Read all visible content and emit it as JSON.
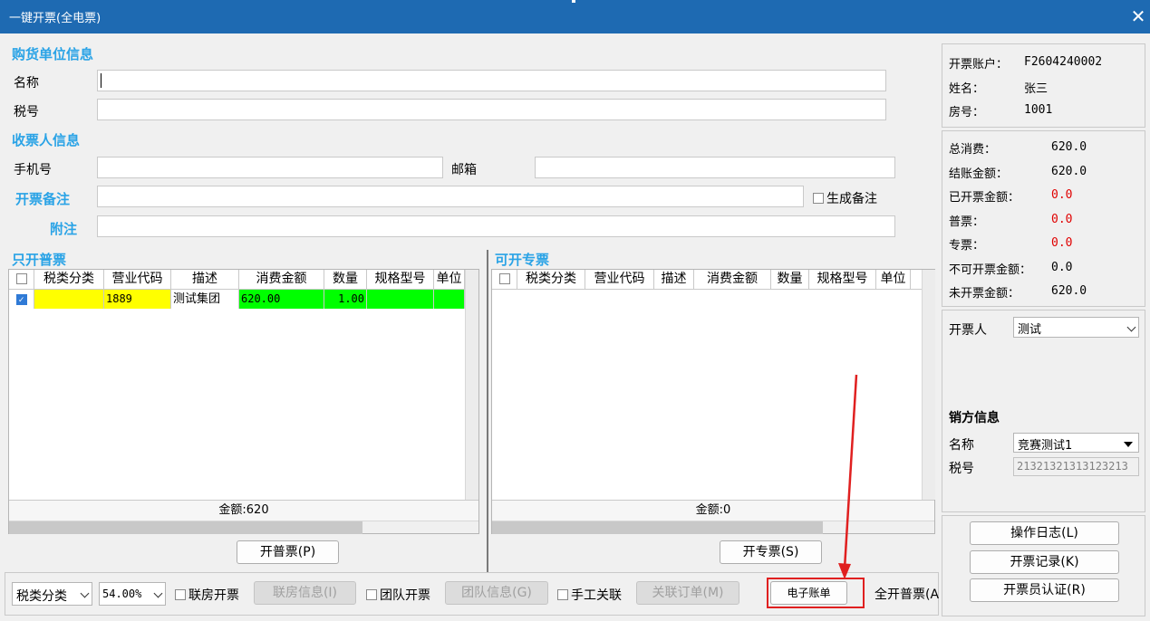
{
  "window": {
    "title": "一键开票(全电票)",
    "close_glyph": "✕"
  },
  "buyer": {
    "section_title": "购货单位信息",
    "name_label": "名称",
    "tax_label": "税号",
    "name_value": "",
    "tax_value": ""
  },
  "receiver": {
    "section_title": "收票人信息",
    "phone_label": "手机号",
    "email_label": "邮箱",
    "phone_value": "",
    "email_value": ""
  },
  "remark": {
    "label": "开票备注",
    "gen_label": "生成备注",
    "value": "",
    "gen_checked": false
  },
  "note": {
    "label": "附注",
    "value": ""
  },
  "left_grid": {
    "title": "只开普票",
    "columns": [
      "税类分类",
      "营业代码",
      "描述",
      "消费金额",
      "数量",
      "规格型号",
      "单位"
    ],
    "rows": [
      {
        "checked": true,
        "tax_class": "",
        "code": "1889",
        "desc": "测试集团",
        "amount": "620.00",
        "qty": "1.00",
        "spec": "",
        "unit": ""
      }
    ],
    "total": "金额:620",
    "button": "开普票(P)"
  },
  "right_grid": {
    "title": "可开专票",
    "columns": [
      "税类分类",
      "营业代码",
      "描述",
      "消费金额",
      "数量",
      "规格型号",
      "单位"
    ],
    "total": "金额:0",
    "button": "开专票(S)"
  },
  "account": {
    "account_label": "开票账户：",
    "account_value": "F2604240002",
    "name_label": "姓名：",
    "name_value": "张三",
    "room_label": "房号：",
    "room_value": "1001"
  },
  "amounts": {
    "total_label": "总消费：",
    "total_value": "620.0",
    "settle_label": "结账金额：",
    "settle_value": "620.0",
    "issued_label": "已开票金额：",
    "issued_value": "0.0",
    "normal_label": "普票：",
    "normal_value": "0.0",
    "special_label": "专票：",
    "special_value": "0.0",
    "nonissuable_label": "不可开票金额：",
    "nonissuable_value": "0.0",
    "unissued_label": "未开票金额：",
    "unissued_value": "620.0"
  },
  "issuer": {
    "label": "开票人",
    "value": "测试"
  },
  "seller": {
    "title": "销方信息",
    "name_label": "名称",
    "name_value": "竞赛测试1",
    "tax_label": "税号",
    "tax_value": "21321321313123213"
  },
  "side_buttons": {
    "log": "操作日志(L)",
    "records": "开票记录(K)",
    "auth": "开票员认证(R)"
  },
  "bottom": {
    "tax_class_select": "税类分类",
    "rate_select": "54.00%",
    "room_invoice": "联房开票",
    "room_info": "联房信息(I)",
    "team_invoice": "团队开票",
    "team_info": "团队信息(G)",
    "manual_link": "手工关联",
    "link_order": "关联订单(M)",
    "ebill": "电子账单",
    "all_normal": "全开普票(A"
  },
  "colors": {
    "title_bar": "#1e6ab2",
    "section": "#2aa3e6",
    "highlight_yellow": "#ffff00",
    "highlight_green": "#00ff00",
    "annotation_red": "#e02020"
  }
}
